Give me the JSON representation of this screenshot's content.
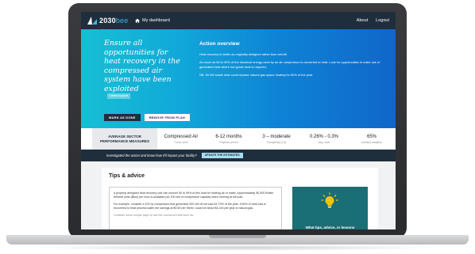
{
  "nav": {
    "logo_main": "2030",
    "logo_accent": "bee",
    "dashboard_link": "My dashboard",
    "about_link": "About",
    "logout_link": "Logout"
  },
  "hero": {
    "title": "Ensure all opportunities for heat recovery in the compressed air system have been exploited",
    "tag": "Useful support",
    "mark_done_label": "MARK AS DONE",
    "remove_label": "REMOVE FROM PLAN",
    "overview_heading": "Action overview",
    "overview_p1": "Heat recovery is better as originally designed rather than retrofit.",
    "overview_p2": "As much as 80 to 90% of the electrical energy used by an air compressor is converted to heat. Look for opportunities to make use of generated heat where low grade heat is required.",
    "overview_p3": "NB: 50 kW waste heat could replace natural gas space heating for 50% of the year."
  },
  "stats": {
    "label": "AVERAGE SECTOR PERFORMANCE MEASURES",
    "items": [
      {
        "value": "Compressed Air",
        "sub": "Focus area"
      },
      {
        "value": "6-12 months",
        "sub": "Payback period"
      },
      {
        "value": "3 – moderate",
        "sub": "Complexity (1-5)"
      },
      {
        "value": "0.26% - 0.3%",
        "sub": "Avg. save"
      },
      {
        "value": "65%",
        "sub": "Industry adoption"
      }
    ]
  },
  "cta": {
    "text": "Investigated the action and know how it'll impact your facility?",
    "button_label": "UPDATE THE ESTIMATES"
  },
  "tips": {
    "title": "Tips & advice",
    "p1": "A properly designed heat recovery unit can recover 50 to 90% of this heat for heating air or water. Approximately 50,000 British thermal units (Btus) per hour is available per 100 cfm of compressor capacity when running at full load.",
    "p2": "For example, consider a 100 hp compressor that generates 200 cfm at full load for 70% of the year. If 50% of heat loss is recovered to heat process water the savings at $0.50 per therm, could be about $4,100 per year in natural gas.",
    "p3": "Consider some simple ways to use the recovered heat such as:",
    "promo_text": "What tips, advice, or lessons"
  },
  "colors": {
    "navbar": "#1e2e3c",
    "hero_start": "#17bfd3",
    "hero_end": "#1066c9",
    "promo": "#1a6e75",
    "cta_button": "#a8dcef"
  }
}
